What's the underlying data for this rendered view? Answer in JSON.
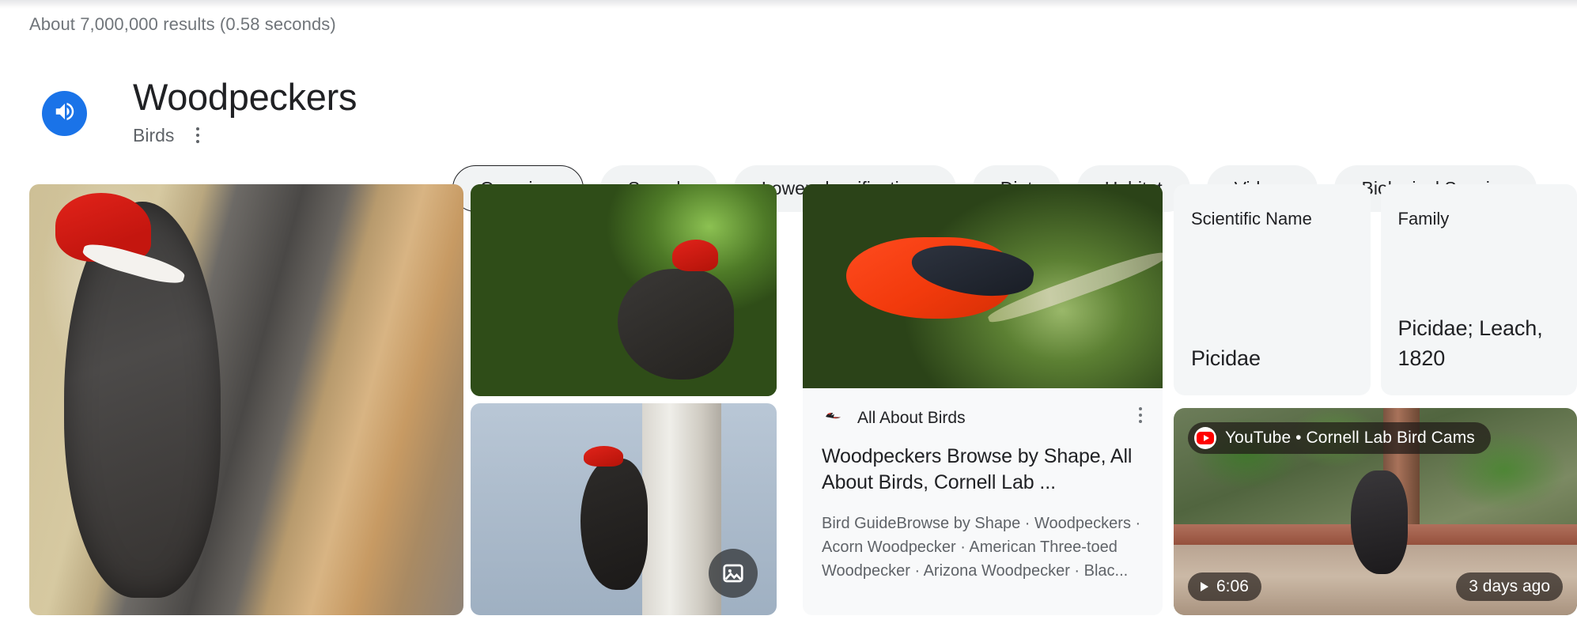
{
  "search": {
    "result_count_text": "About 7,000,000 results (0.58 seconds)"
  },
  "knowledge_panel": {
    "title": "Woodpeckers",
    "subtitle": "Birds",
    "sound_icon": "speaker-icon",
    "more_icon": "more-options-icon",
    "tabs": [
      {
        "label": "Overview",
        "selected": true
      },
      {
        "label": "Sounds",
        "selected": false
      },
      {
        "label": "Lower classifications",
        "selected": false
      },
      {
        "label": "Diet",
        "selected": false
      },
      {
        "label": "Habitat",
        "selected": false
      },
      {
        "label": "Videos",
        "selected": false
      },
      {
        "label": "Biological Species",
        "selected": false
      }
    ]
  },
  "gallery": {
    "main_image_alt": "Pileated woodpecker on shredded tree trunk",
    "sub_images": [
      {
        "alt": "Pileated woodpecker clinging to mossy trunk with green foliage"
      },
      {
        "alt": "Pileated woodpecker on white birch trunk against blue sky"
      }
    ],
    "image_badge_icon": "image-icon"
  },
  "result_card": {
    "favicon_icon": "all-about-birds-favicon",
    "source": "All About Birds",
    "more_icon": "more-options-icon",
    "title": "Woodpeckers Browse by Shape, All About Birds, Cornell Lab ...",
    "snippet": "Bird GuideBrowse by Shape · Woodpeckers · Acorn Woodpecker · American Three-toed Woodpecker · Arizona Woodpecker · Blac...",
    "thumbnail_alt": "Scarlet tanager perched on a lichen-covered branch"
  },
  "facts": [
    {
      "label": "Scientific Name",
      "value": "Picidae"
    },
    {
      "label": "Family",
      "value": "Picidae; Leach, 1820"
    }
  ],
  "video_card": {
    "platform_icon": "youtube-icon",
    "platform_label": "YouTube • Cornell Lab Bird Cams",
    "play_icon": "play-icon",
    "duration": "6:06",
    "age": "3 days ago",
    "thumbnail_alt": "Woodpecker at a bird feeder in a garden"
  },
  "colors": {
    "accent_blue": "#1a73e8",
    "tab_background": "#f1f3f4",
    "tab_selected_border": "#202124",
    "card_background": "#f8f9fa",
    "fact_card_background": "#f4f6f7",
    "text_primary": "#202124",
    "text_secondary": "#5f6368",
    "text_muted": "#70757a",
    "youtube_red": "#ff0000"
  }
}
